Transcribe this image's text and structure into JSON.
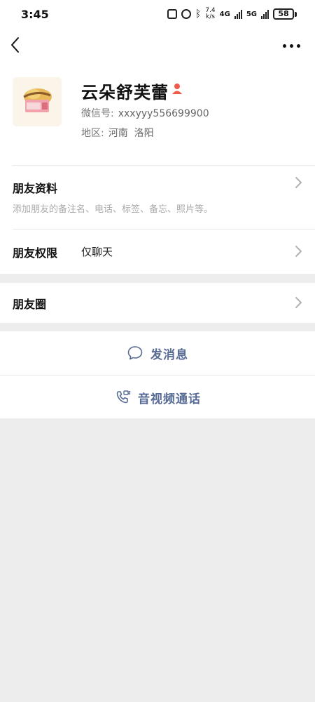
{
  "status_bar": {
    "time": "3:45",
    "speed_top": "7.4",
    "speed_bottom": "k/s",
    "network_1": "4G",
    "network_2": "5G",
    "battery": "58"
  },
  "profile": {
    "name": "云朵舒芙蕾",
    "wechat_id_label": "微信号:",
    "wechat_id": "xxxyyy556699900",
    "region_label": "地区:",
    "region_value": "河南  洛阳"
  },
  "rows": {
    "friend_info": {
      "title": "朋友资料",
      "desc": "添加朋友的备注名、电话、标签、备忘、照片等。"
    },
    "friend_permissions": {
      "title": "朋友权限",
      "value": "仅聊天"
    },
    "moments": {
      "title": "朋友圈"
    }
  },
  "actions": {
    "send_message": "发消息",
    "video_call": "音视频通话"
  },
  "colors": {
    "accent": "#576b95",
    "page_background": "#ededed",
    "badge": "#f05a4b"
  },
  "icons": [
    "back-arrow-icon",
    "more-dots-icon",
    "person-badge-icon",
    "chevron-right-icon",
    "chat-bubble-icon",
    "phone-video-icon"
  ]
}
